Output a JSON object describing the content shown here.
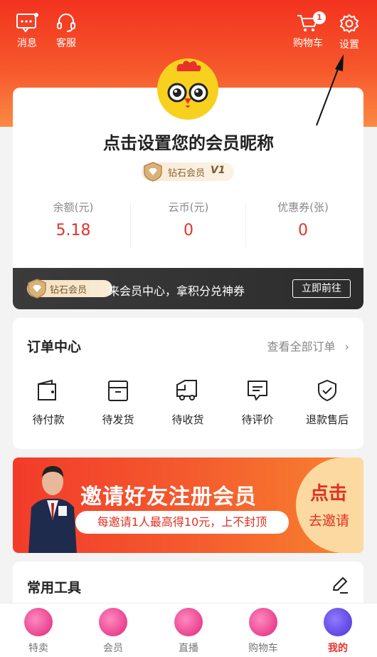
{
  "header": {
    "messages_label": "消息",
    "service_label": "客服",
    "cart_label": "购物车",
    "cart_badge": "1",
    "settings_label": "设置"
  },
  "profile": {
    "nickname_prompt": "点击设置您的会员昵称",
    "vip_level_label": "钻石会员",
    "vip_level_mark": "V1",
    "stats": [
      {
        "label": "余额(元)",
        "value": "5.18"
      },
      {
        "label": "云币(元)",
        "value": "0"
      },
      {
        "label": "优惠券(张)",
        "value": "0"
      }
    ]
  },
  "vip_banner": {
    "tag": "钻石会员",
    "message": "来会员中心，拿积分兑神券",
    "button": "立即前往"
  },
  "orders": {
    "title": "订单中心",
    "view_all": "查看全部订单",
    "items": [
      {
        "label": "待付款",
        "icon": "wallet-icon"
      },
      {
        "label": "待发货",
        "icon": "box-icon"
      },
      {
        "label": "待收货",
        "icon": "truck-icon"
      },
      {
        "label": "待评价",
        "icon": "comment-icon"
      },
      {
        "label": "退款售后",
        "icon": "shield-check-icon"
      }
    ]
  },
  "invite_banner": {
    "headline": "邀请好友注册会员",
    "sub": "每邀请1人最高得10元，上不封顶",
    "cta_top": "点击",
    "cta_bottom": "去邀请"
  },
  "tools": {
    "title": "常用工具"
  },
  "tabbar": {
    "items": [
      {
        "label": "特卖",
        "active": false
      },
      {
        "label": "会员",
        "active": false
      },
      {
        "label": "直播",
        "active": false
      },
      {
        "label": "购物车",
        "active": false
      },
      {
        "label": "我的",
        "active": true
      }
    ]
  },
  "colors": {
    "brand_red": "#f3331f",
    "price_red": "#e6322a",
    "active_tab": "#e6322a",
    "vip_gold": "#f4dfbf"
  }
}
